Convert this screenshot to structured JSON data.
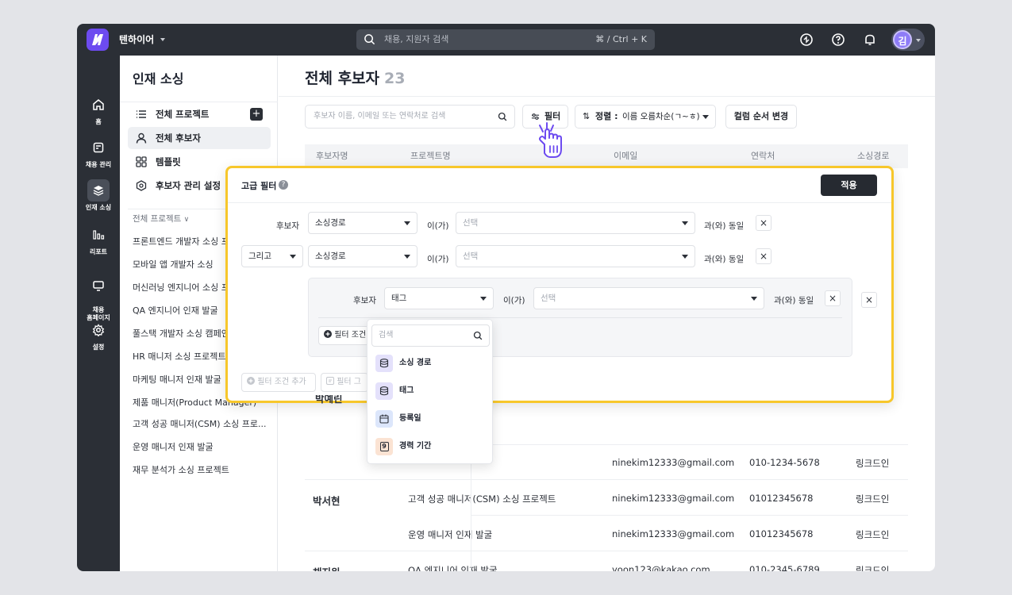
{
  "app": {
    "workspace": "텐하이어",
    "search_placeholder": "채용, 지원자 검색",
    "search_shortcut": "⌘ / Ctrl + K",
    "user_initial": "김",
    "accent": "#6d4bf0"
  },
  "rail": [
    {
      "label": "홈",
      "icon": "home-icon"
    },
    {
      "label": "채용 관리",
      "icon": "clipboard-icon"
    },
    {
      "label": "인재 소싱",
      "icon": "layers-icon",
      "active": true
    },
    {
      "label": "리포트",
      "icon": "bar-chart-icon"
    },
    {
      "label": "채용\n홈페이지",
      "icon": "monitor-icon"
    },
    {
      "label": "설정",
      "icon": "gear-icon"
    }
  ],
  "sidebar": {
    "title": "인재 소싱",
    "nav": [
      {
        "label": "전체 프로젝트",
        "icon": "list-icon"
      },
      {
        "label": "전체 후보자",
        "icon": "person-icon",
        "active": true
      },
      {
        "label": "템플릿",
        "icon": "grid-icon"
      },
      {
        "label": "후보자 관리 설정",
        "icon": "settings-hex-icon"
      }
    ],
    "projects_header": "전체 프로젝트",
    "projects": [
      "프론트엔드 개발자 소싱 프로젝트",
      "모바일 앱 개발자 소싱",
      "머신러닝 엔지니어 소싱 프로젝트",
      "QA 엔지니어 인재 발굴",
      "풀스택 개발자 소싱 캠페인",
      "HR 매니저 소싱 프로젝트",
      "마케팅 매니저 인재 발굴",
      "제품 매니저(Product Manager)",
      "고객 성공 매니저(CSM) 소싱 프로...",
      "운영 매니저 인재 발굴",
      "재무 분석가 소싱 프로젝트"
    ]
  },
  "main": {
    "title": "전체 후보자",
    "count": "23",
    "search_placeholder": "후보자 이름, 이메일 또는 연락처로 검색",
    "filter_label": "필터",
    "sort_prefix": "정렬 :",
    "sort_value": "이름 오름차순(ㄱ~ㅎ)",
    "column_order_label": "컬럼 순서 변경",
    "columns": [
      "후보자명",
      "프로젝트명",
      "이메일",
      "연락처",
      "소싱경로"
    ]
  },
  "rows": [
    {
      "name": "",
      "project": "",
      "email": "ninekim12333@gmail.com",
      "phone": "010-1234-5678",
      "source": "링크드인"
    },
    {
      "name": "박서현",
      "project": "고객 성공 매니저(CSM) 소싱 프로젝트",
      "email": "ninekim12333@gmail.com",
      "phone": "01012345678",
      "source": "링크드인"
    },
    {
      "name": "",
      "project": "운영 매니저 인재 발굴",
      "email": "ninekim12333@gmail.com",
      "phone": "01012345678",
      "source": "링크드인"
    },
    {
      "name": "채지원",
      "project": "QA 엔지니어 인재 발굴",
      "email": "yoon123@kakao.com",
      "phone": "010-2345-6789",
      "source": "링크드인"
    }
  ],
  "filter_modal": {
    "title": "고급 필터",
    "apply_label": "적용",
    "subject": "후보자",
    "conj": "그리고",
    "cond1_field": "소싱경로",
    "cond2_field": "소싱경로",
    "group_field": "태그",
    "is_label": "이(가)",
    "value_placeholder": "선택",
    "equals_label": "과(와) 동일",
    "add_condition": "필터 조건 추가",
    "add_condition_short": "필터 조건",
    "add_group": "필터 그룹 추가",
    "add_group_short": "필터 그"
  },
  "field_dropdown": {
    "search_placeholder": "검색",
    "options": [
      {
        "label": "소싱 경로",
        "icon": "database-icon"
      },
      {
        "label": "태그",
        "icon": "database-icon"
      },
      {
        "label": "등록일",
        "icon": "calendar-icon"
      },
      {
        "label": "경력 기간",
        "icon": "number-icon",
        "badge": "9"
      }
    ]
  }
}
